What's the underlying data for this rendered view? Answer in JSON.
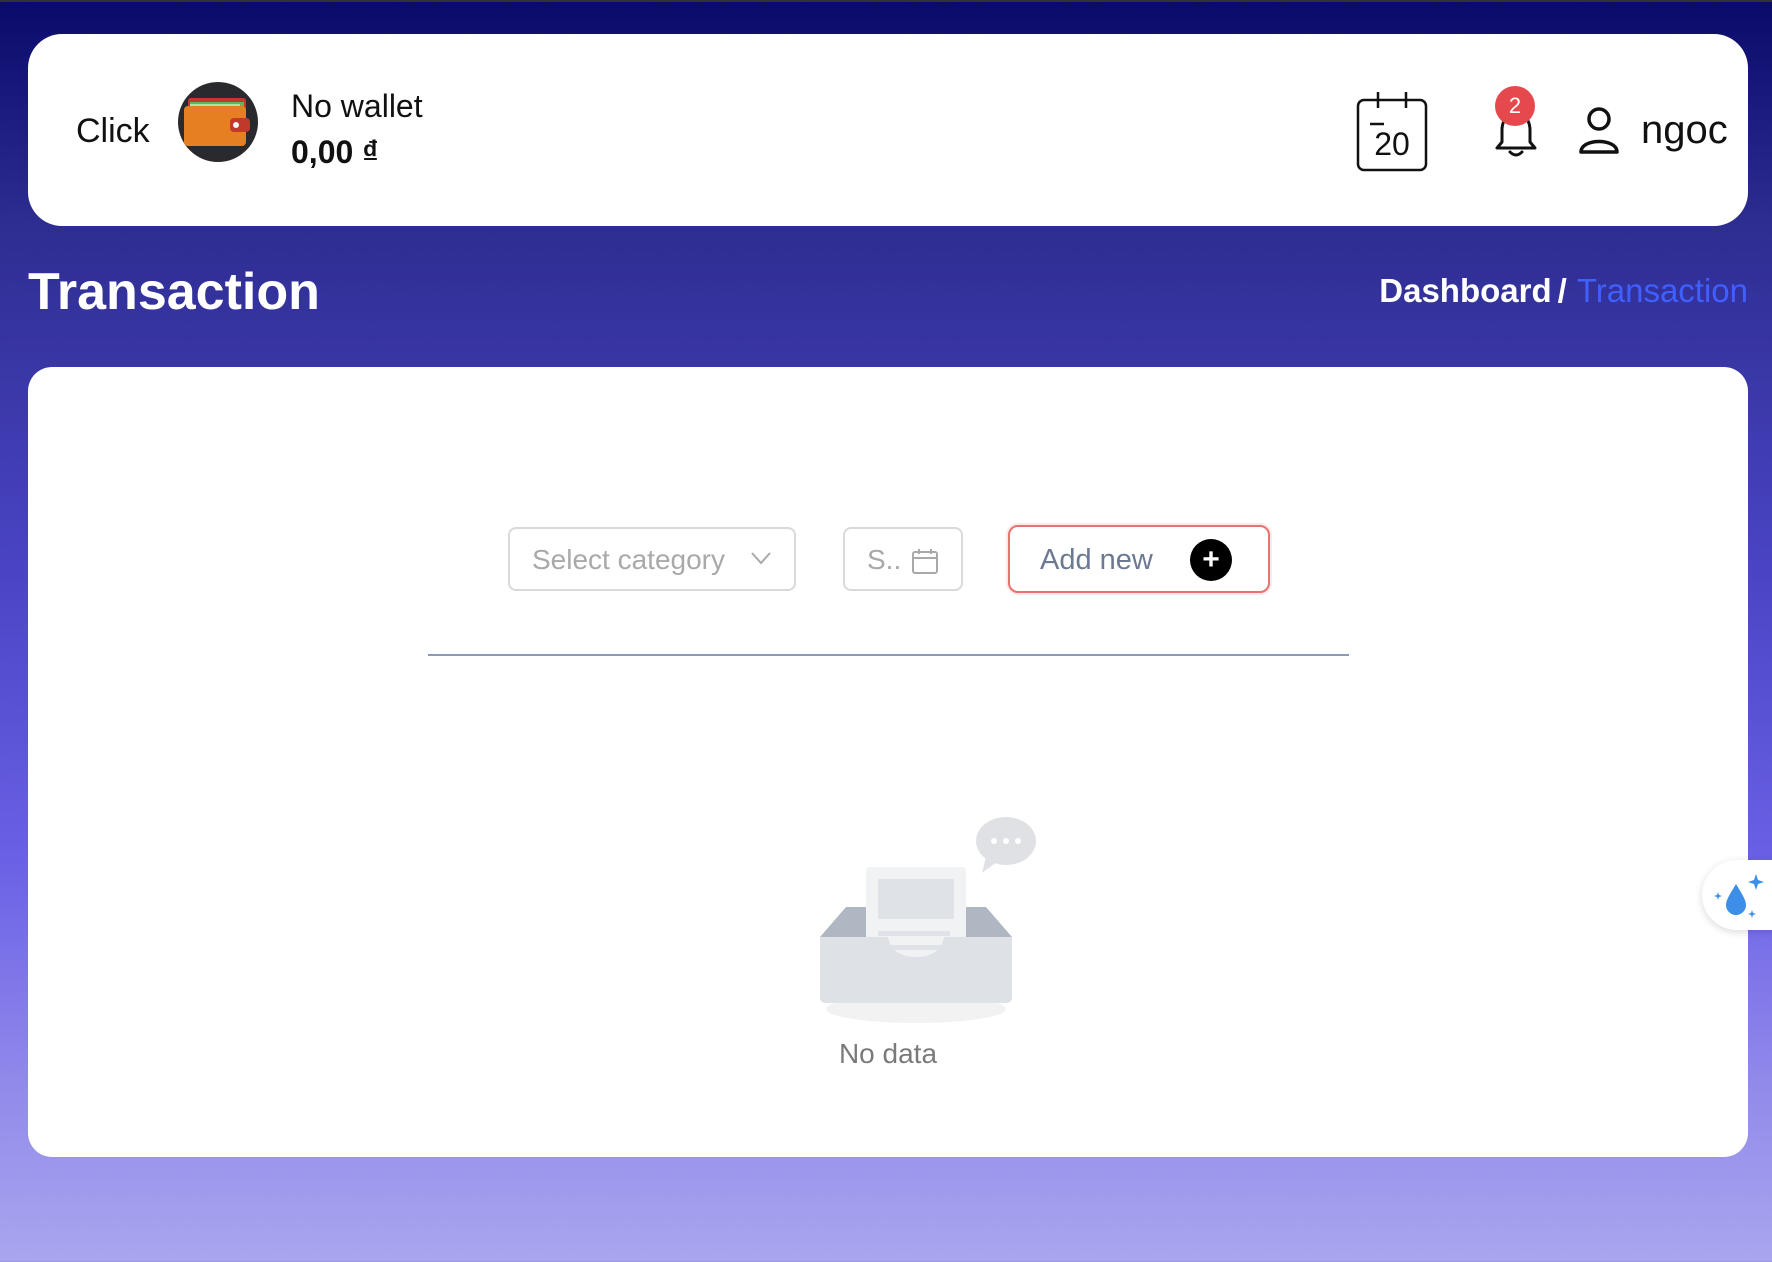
{
  "header": {
    "click_label": "Click",
    "wallet_name": "No wallet",
    "wallet_balance": "0,00 ₫",
    "calendar_day": "20",
    "notification_count": "2",
    "username": "ngoc"
  },
  "page": {
    "title": "Transaction",
    "breadcrumb": {
      "dashboard": "Dashboard",
      "separator": "/",
      "current": "Transaction"
    }
  },
  "filters": {
    "category_placeholder": "Select category",
    "date_placeholder": "S..",
    "add_new_label": "Add new",
    "add_new_icon": "+"
  },
  "empty_state": {
    "text": "No data"
  },
  "colors": {
    "accent_breadcrumb": "#3f5fff",
    "badge": "#e5484d",
    "add_new_border": "#e8726f"
  },
  "icons": [
    "wallet-icon",
    "calendar-icon",
    "bell-icon",
    "user-icon",
    "chevron-down-icon",
    "calendar-small-icon",
    "plus-icon",
    "empty-inbox-icon",
    "water-drop-sparkle-icon"
  ]
}
